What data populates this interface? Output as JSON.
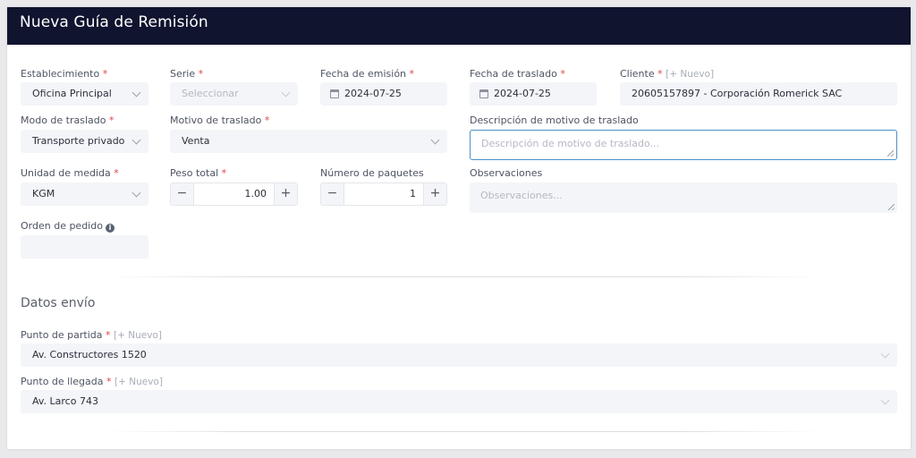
{
  "header": {
    "title": "Nueva Guía de Remisión"
  },
  "establecimiento": {
    "label": "Establecimiento",
    "value": "Oficina Principal"
  },
  "serie": {
    "label": "Serie",
    "placeholder": "Seleccionar"
  },
  "fecha_emision": {
    "label": "Fecha de emisión",
    "value": "2024-07-25"
  },
  "fecha_traslado": {
    "label": "Fecha de traslado",
    "value": "2024-07-25"
  },
  "cliente": {
    "label": "Cliente",
    "nuevo": "[+ Nuevo]",
    "value": "20605157897 - Corporación Romerick SAC"
  },
  "modo_traslado": {
    "label": "Modo de traslado",
    "value": "Transporte privado"
  },
  "motivo_traslado": {
    "label": "Motivo de traslado",
    "value": "Venta"
  },
  "descripcion_motivo": {
    "label": "Descripción de motivo de traslado",
    "placeholder": "Descripción de motivo de traslado..."
  },
  "unidad_medida": {
    "label": "Unidad de medida",
    "value": "KGM"
  },
  "peso_total": {
    "label": "Peso total",
    "value": "1.00",
    "minus": "−",
    "plus": "+"
  },
  "numero_paquetes": {
    "label": "Número de paquetes",
    "value": "1",
    "minus": "−",
    "plus": "+"
  },
  "observaciones": {
    "label": "Observaciones",
    "placeholder": "Observaciones..."
  },
  "orden_pedido": {
    "label": "Orden de pedido",
    "info": "i"
  },
  "datos_envio": {
    "title": "Datos envío"
  },
  "punto_partida": {
    "label": "Punto de partida",
    "nuevo": "[+ Nuevo]",
    "value": "Av. Constructores 1520"
  },
  "punto_llegada": {
    "label": "Punto de llegada",
    "nuevo": "[+ Nuevo]",
    "value": "Av. Larco 743"
  },
  "required_mark": "*"
}
